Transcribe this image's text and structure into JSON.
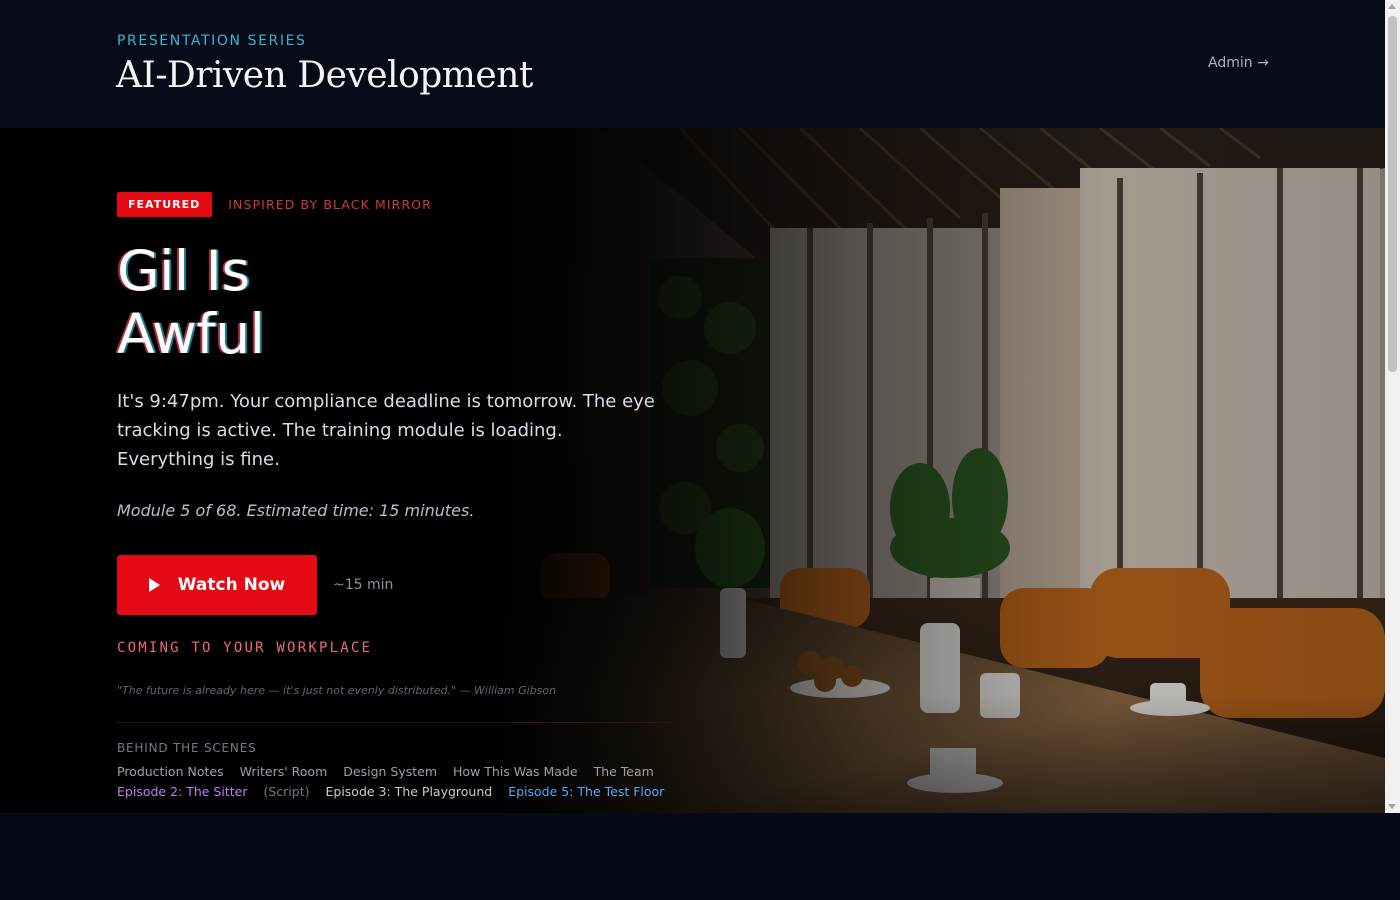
{
  "header": {
    "series_label": "PRESENTATION SERIES",
    "title": "AI-Driven Development",
    "admin_link": "Admin →"
  },
  "hero": {
    "badge": "FEATURED",
    "inspired_by": "INSPIRED BY BLACK MIRROR",
    "title_line1": "Gil Is",
    "title_line2": "Awful",
    "synopsis": "It's 9:47pm. Your compliance deadline is tomorrow. The eye tracking is active. The training module is loading. Everything is fine.",
    "module_info": "Module 5 of 68. Estimated time: 15 minutes.",
    "watch_button": "Watch Now",
    "duration": "~15 min",
    "tagline": "COMING TO YOUR WORKPLACE",
    "quote": "\"The future is already here — it's just not evenly distributed.\" — William Gibson",
    "background_image": "office-meeting-room-image"
  },
  "behind_the_scenes": {
    "heading": "BEHIND THE SCENES",
    "links_row1": [
      "Production Notes",
      "Writers' Room",
      "Design System",
      "How This Was Made",
      "The Team"
    ],
    "links_row2": [
      "Episode 2: The Sitter",
      "(Script)",
      "Episode 3: The Playground",
      "Episode 5: The Test Floor"
    ]
  },
  "colors": {
    "accent_red": "#e50914",
    "series_cyan": "#35b6d8",
    "background": "#050a16",
    "link_purple": "#c17cf2",
    "link_blue": "#5aa6f5"
  }
}
